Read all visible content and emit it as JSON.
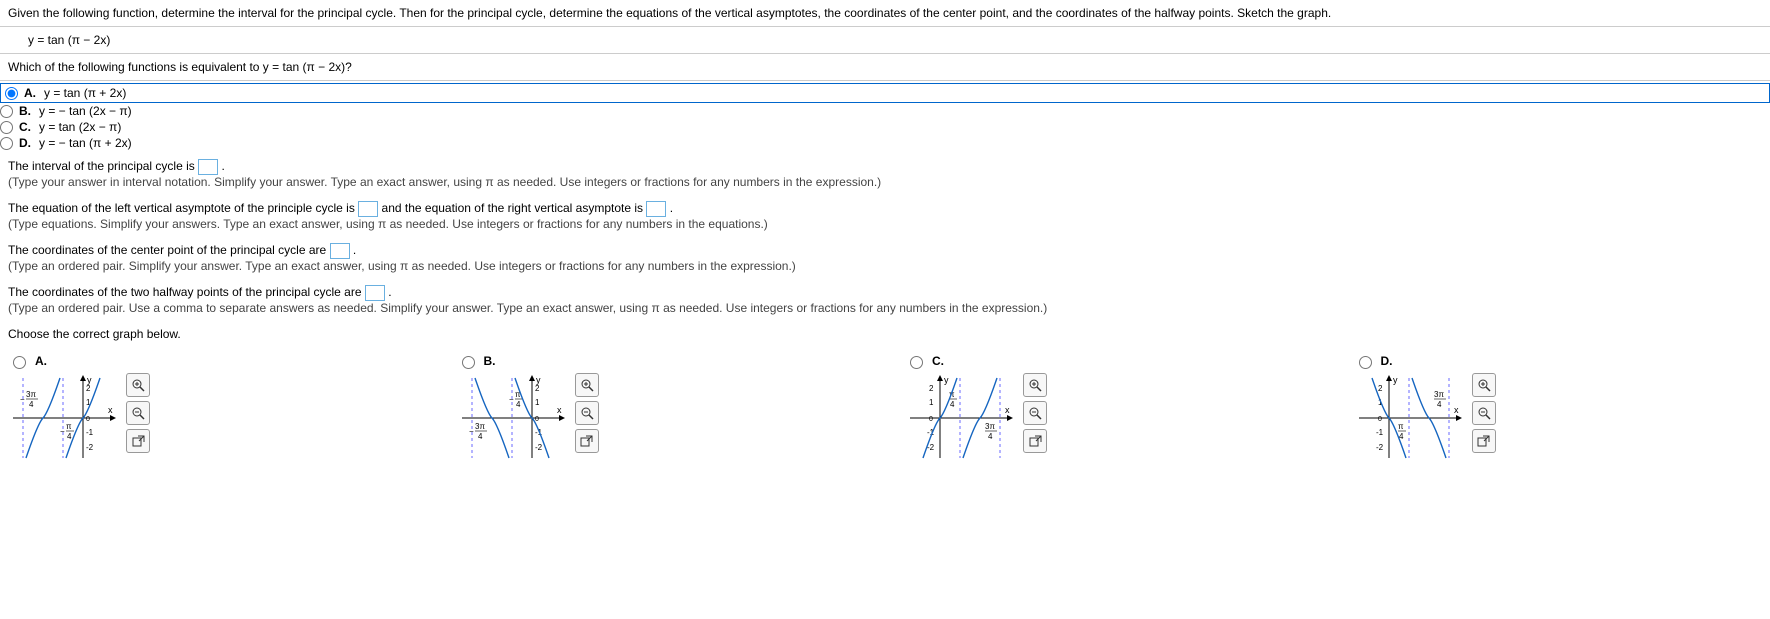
{
  "prompt": "Given the following function, determine the interval for the principal cycle. Then for the principal cycle, determine the equations of the vertical asymptotes, the coordinates of the center point, and the coordinates of the halfway points. Sketch the graph.",
  "given_fn": "y = tan (π − 2x)",
  "equiv_q": "Which of the following functions is equivalent to y = tan (π − 2x)?",
  "options": {
    "A": "y = tan (π + 2x)",
    "B": "y = − tan (2x − π)",
    "C": "y = tan (2x − π)",
    "D": "y = − tan (π + 2x)"
  },
  "letters": {
    "A": "A.",
    "B": "B.",
    "C": "C.",
    "D": "D."
  },
  "interval_line": "The interval of the principal cycle is ",
  "interval_hint": "(Type your answer in interval notation. Simplify your answer. Type an exact answer, using π as needed. Use integers or fractions for any numbers in the expression.)",
  "asym_pre": "The equation of the left vertical asymptote of the principle cycle is ",
  "asym_mid": " and the equation of the right vertical asymptote is ",
  "asym_hint": "(Type equations. Simplify your answers. Type an exact answer, using π as needed. Use integers or fractions for any numbers in the equations.)",
  "center_line": "The coordinates of the center point of the principal cycle are ",
  "center_hint": "(Type an ordered pair. Simplify your answer. Type an exact answer, using π as needed. Use integers or fractions for any numbers in the expression.)",
  "halfway_line": "The coordinates of the two halfway points of the principal cycle are ",
  "halfway_hint": "(Type an ordered pair. Use a comma to separate answers as needed. Simplify your answer. Type an exact answer, using π as needed. Use integers or fractions for any numbers in the expression.)",
  "choose_graph": "Choose the correct graph below.",
  "period": ".",
  "graph_letters": {
    "A": "A.",
    "B": "B.",
    "C": "C.",
    "D": "D."
  }
}
